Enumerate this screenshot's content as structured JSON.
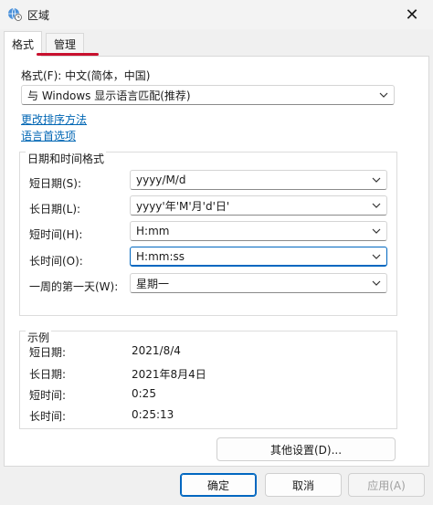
{
  "window": {
    "title": "区域",
    "close_glyph": "✕"
  },
  "tabs": [
    {
      "label": "格式",
      "active": true
    },
    {
      "label": "管理",
      "active": false
    }
  ],
  "colors": {
    "accent": "#0067c0",
    "link": "#0066b4",
    "tab_highlight": "#c8102e"
  },
  "format": {
    "label": "格式(F): 中文(简体，中国)",
    "selected": "与 Windows 显示语言匹配(推荐)"
  },
  "links": {
    "sort": "更改排序方法",
    "language": "语言首选项"
  },
  "datetime": {
    "group_title": "日期和时间格式",
    "rows": [
      {
        "label": "短日期(S):",
        "value": "yyyy/M/d"
      },
      {
        "label": "长日期(L):",
        "value": "yyyy'年'M'月'd'日'"
      },
      {
        "label": "短时间(H):",
        "value": "H:mm"
      },
      {
        "label": "长时间(O):",
        "value": "H:mm:ss"
      },
      {
        "label": "一周的第一天(W):",
        "value": "星期一"
      }
    ]
  },
  "examples": {
    "group_title": "示例",
    "rows": [
      {
        "label": "短日期:",
        "value": "2021/8/4"
      },
      {
        "label": "长日期:",
        "value": "2021年8月4日"
      },
      {
        "label": "短时间:",
        "value": "0:25"
      },
      {
        "label": "长时间:",
        "value": "0:25:13"
      }
    ]
  },
  "buttons": {
    "other_settings": "其他设置(D)...",
    "ok": "确定",
    "cancel": "取消",
    "apply": "应用(A)"
  }
}
